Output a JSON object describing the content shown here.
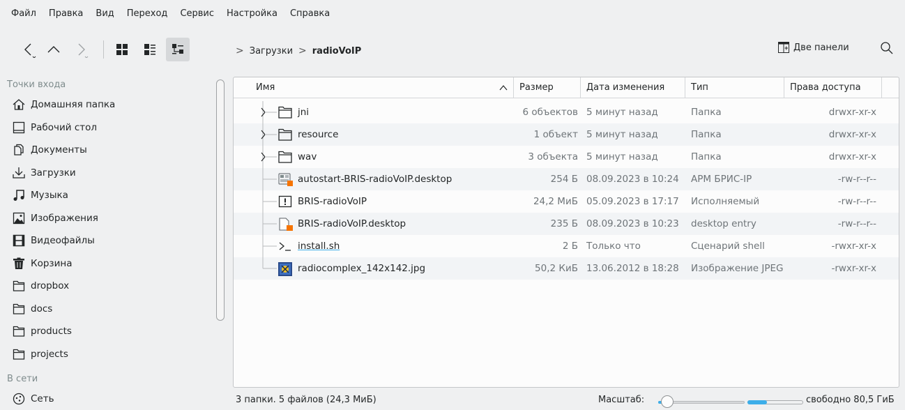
{
  "menu": [
    "Файл",
    "Правка",
    "Вид",
    "Переход",
    "Сервис",
    "Настройка",
    "Справка"
  ],
  "breadcrumb": {
    "parent": "Загрузки",
    "current": "radioVoIP"
  },
  "toolbar": {
    "dual_panel": "Две панели"
  },
  "places": {
    "section_entry": "Точки входа",
    "items": [
      {
        "label": "Домашняя папка",
        "icon": "home-icon"
      },
      {
        "label": "Рабочий стол",
        "icon": "desktop-icon"
      },
      {
        "label": "Документы",
        "icon": "documents-icon"
      },
      {
        "label": "Загрузки",
        "icon": "downloads-icon"
      },
      {
        "label": "Музыка",
        "icon": "music-icon"
      },
      {
        "label": "Изображения",
        "icon": "pictures-icon"
      },
      {
        "label": "Видеофайлы",
        "icon": "videos-icon"
      },
      {
        "label": "Корзина",
        "icon": "trash-icon"
      },
      {
        "label": "dropbox",
        "icon": "folder-icon"
      },
      {
        "label": "docs",
        "icon": "folder-icon"
      },
      {
        "label": "products",
        "icon": "folder-icon"
      },
      {
        "label": "projects",
        "icon": "folder-icon"
      }
    ],
    "section_network": "В сети",
    "network_item": "Сеть"
  },
  "columns": {
    "name": "Имя",
    "size": "Размер",
    "modified": "Дата изменения",
    "type": "Тип",
    "perms": "Права доступа"
  },
  "files": [
    {
      "name": "jni",
      "size": "6 объектов",
      "modified": "5 минут назад",
      "type": "Папка",
      "perms": "drwxr-xr-x",
      "icon": "folder"
    },
    {
      "name": "resource",
      "size": "1 объект",
      "modified": "5 минут назад",
      "type": "Папка",
      "perms": "drwxr-xr-x",
      "icon": "folder"
    },
    {
      "name": "wav",
      "size": "3 объекта",
      "modified": "5 минут назад",
      "type": "Папка",
      "perms": "drwxr-xr-x",
      "icon": "folder"
    },
    {
      "name": "autostart-BRIS-radioVoIP.desktop",
      "size": "254 Б",
      "modified": "08.09.2023 в 10:24",
      "type": "АРМ БРИС-IP",
      "perms": "-rw-r--r--",
      "icon": "app-desktop"
    },
    {
      "name": "BRIS-radioVoIP",
      "size": "24,2 МиБ",
      "modified": "05.09.2023 в 17:17",
      "type": "Исполняемый",
      "perms": "-rw-r--r--",
      "icon": "exec"
    },
    {
      "name": "BRIS-radioVoIP.desktop",
      "size": "235 Б",
      "modified": "08.09.2023 в 10:23",
      "type": "desktop entry",
      "perms": "-rw-r--r--",
      "icon": "desktop-file"
    },
    {
      "name": "install.sh",
      "size": "2 Б",
      "modified": "Только что",
      "type": "Сценарий shell",
      "perms": "-rwxr-xr-x",
      "icon": "shell"
    },
    {
      "name": "radiocomplex_142x142.jpg",
      "size": "50,2 КиБ",
      "modified": "13.06.2012 в 18:28",
      "type": "Изображение JPEG",
      "perms": "-rwxr-xr-x",
      "icon": "image"
    }
  ],
  "status": {
    "summary": "3 папки. 5 файлов (24,3 МиБ)",
    "zoom_label": "Масштаб:",
    "free_space": "свободно 80,5 ГиБ",
    "zoom_level": 0.05,
    "disk_used_fraction": 0.35
  },
  "colors": {
    "accent": "#3daee9",
    "background": "#eff0f1",
    "view": "#fcfcfc",
    "warning": "#f67400"
  }
}
